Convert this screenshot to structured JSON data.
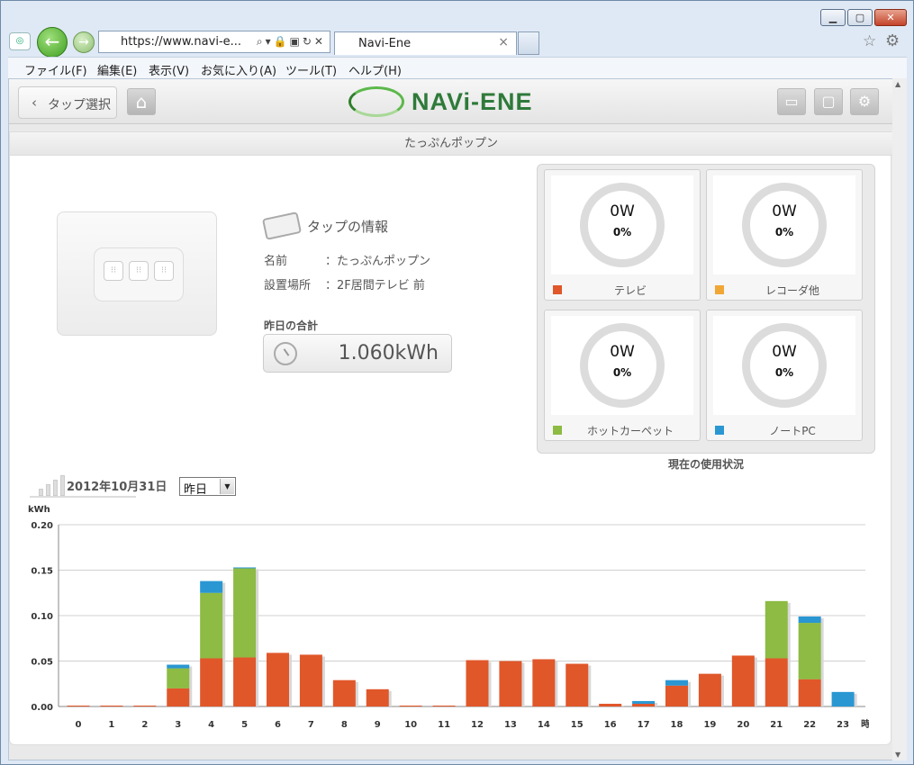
{
  "browser": {
    "url": "https://www.navi-e...",
    "tab_title": "Navi-Ene",
    "tab_close": "×",
    "menu": [
      "ファイル(F)",
      "編集(E)",
      "表示(V)",
      "お気に入り(A)",
      "ツール(T)",
      "ヘルプ(H)"
    ]
  },
  "app": {
    "back_label": "タップ選択",
    "brand": "NAVi-ENE"
  },
  "panel": {
    "title": "たっぷんポップン"
  },
  "tap_info": {
    "heading": "タップの情報",
    "name_label": "名前",
    "name_value": "：たっぷんポップン",
    "location_label": "設置場所",
    "location_value": "：2F居間テレビ 前",
    "yesterday_label": "昨日の合計",
    "yesterday_value": "1.060kWh"
  },
  "usage": {
    "caption": "現在の使用状況",
    "outlets": [
      {
        "watts": "0W",
        "percent": "0%",
        "label": "テレビ",
        "color": "#e0572a"
      },
      {
        "watts": "0W",
        "percent": "0%",
        "label": "レコーダ他",
        "color": "#f0a736"
      },
      {
        "watts": "0W",
        "percent": "0%",
        "label": "ホットカーペット",
        "color": "#8dbb43"
      },
      {
        "watts": "0W",
        "percent": "0%",
        "label": "ノートPC",
        "color": "#2a97d2"
      }
    ]
  },
  "history": {
    "date": "2012年10月31日",
    "period": "昨日"
  },
  "chart_data": {
    "type": "bar",
    "stacked": true,
    "ylabel": "kWh",
    "xunit": "時",
    "ylim": [
      0,
      0.2
    ],
    "yticks": [
      "0.00",
      "0.05",
      "0.10",
      "0.15",
      "0.20"
    ],
    "grid": true,
    "categories": [
      "0",
      "1",
      "2",
      "3",
      "4",
      "5",
      "6",
      "7",
      "8",
      "9",
      "10",
      "11",
      "12",
      "13",
      "14",
      "15",
      "16",
      "17",
      "18",
      "19",
      "20",
      "21",
      "22",
      "23"
    ],
    "series": [
      {
        "color": "#e0572a",
        "values": [
          0.001,
          0.001,
          0.001,
          0.02,
          0.053,
          0.054,
          0.059,
          0.057,
          0.029,
          0.019,
          0.001,
          0.001,
          0.051,
          0.05,
          0.052,
          0.047,
          0.003,
          0.003,
          0.023,
          0.036,
          0.056,
          0.053,
          0.03,
          0.0
        ]
      },
      {
        "color": "#f0a736",
        "values": [
          0,
          0,
          0,
          0,
          0,
          0,
          0,
          0,
          0,
          0,
          0,
          0,
          0,
          0,
          0,
          0,
          0,
          0,
          0,
          0,
          0,
          0,
          0,
          0
        ]
      },
      {
        "color": "#8dbb43",
        "values": [
          0,
          0,
          0,
          0.022,
          0.072,
          0.098,
          0,
          0,
          0,
          0,
          0,
          0,
          0,
          0,
          0,
          0,
          0,
          0,
          0,
          0,
          0,
          0.063,
          0.062,
          0
        ]
      },
      {
        "color": "#2a97d2",
        "values": [
          0,
          0,
          0,
          0.004,
          0.013,
          0.001,
          0,
          0,
          0,
          0,
          0,
          0,
          0,
          0,
          0,
          0,
          0,
          0.003,
          0.006,
          0,
          0,
          0,
          0.007,
          0.016
        ]
      }
    ]
  }
}
